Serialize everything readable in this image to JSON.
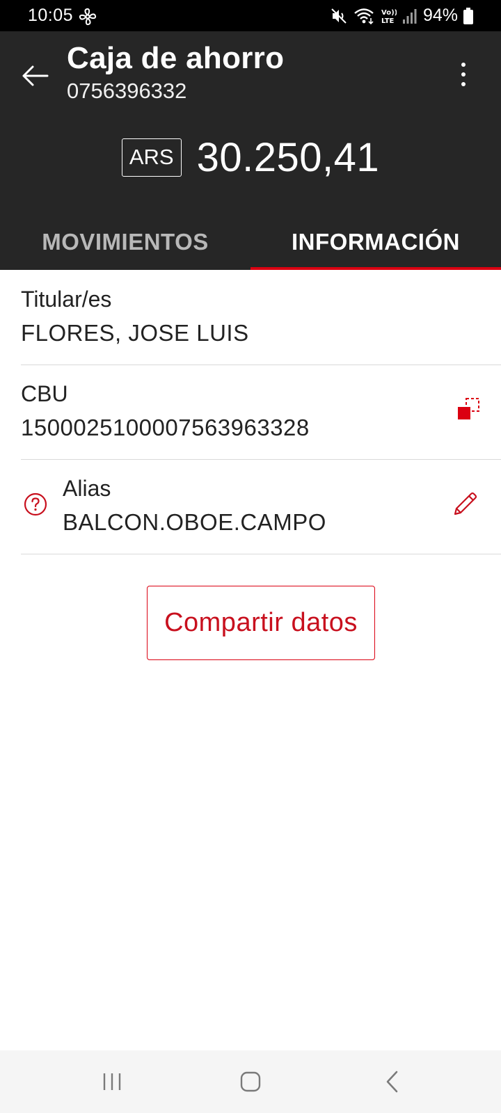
{
  "status_bar": {
    "time": "10:05",
    "battery": "94%",
    "icons": [
      "fan-icon",
      "mute-icon",
      "wifi-icon",
      "volte-icon",
      "signal-icon",
      "battery-icon"
    ]
  },
  "header": {
    "title": "Caja de ahorro",
    "account_number": "0756396332",
    "currency": "ARS",
    "balance": "30.250,41",
    "background_color": "#262626"
  },
  "tabs": [
    {
      "label": "MOVIMIENTOS",
      "selected": false
    },
    {
      "label": "INFORMACIÓN",
      "selected": true
    }
  ],
  "info": {
    "titular": {
      "label": "Titular/es",
      "value": "FLORES, JOSE LUIS"
    },
    "cbu": {
      "label": "CBU",
      "value": "1500025100007563963328",
      "action_icon": "copy-icon"
    },
    "alias": {
      "label": "Alias",
      "value": "BALCON.OBOE.CAMPO",
      "help_icon": "help-icon",
      "action_icon": "edit-icon"
    }
  },
  "share_button": {
    "label": "Compartir datos"
  },
  "colors": {
    "accent": "#db0011",
    "accent_text": "#c8101e",
    "divider": "#d9d9d9"
  }
}
